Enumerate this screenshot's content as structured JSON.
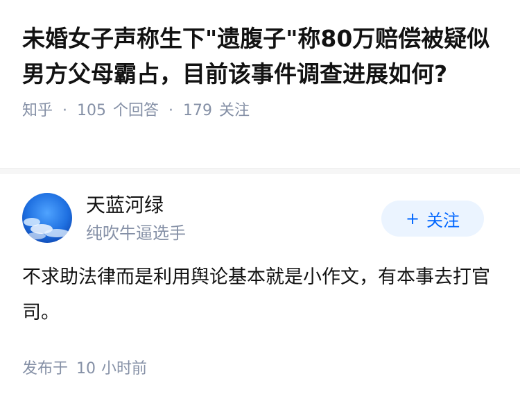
{
  "question": {
    "title": "未婚女子声称生下\"遗腹子\"称80万赔偿被疑似男方父母霸占，目前该事件调查进展如何?",
    "source": "知乎",
    "answer_count": "105",
    "answer_label": "个回答",
    "follower_count": "179",
    "follower_label": "关注"
  },
  "answer": {
    "author": {
      "name": "天蓝河绿",
      "headline": "纯吹牛逼选手",
      "avatar_icon": "sky-clouds-avatar"
    },
    "follow_button": {
      "icon": "plus-icon",
      "plus": "+",
      "label": "关注"
    },
    "content": "不求助法律而是利用舆论基本就是小作文，有本事去打官司。",
    "time_prefix": "发布于",
    "time_value": "10",
    "time_unit": "小时前"
  },
  "colors": {
    "meta_gray": "#8590a6",
    "accent_blue": "#0066ff",
    "follow_bg": "#ebf4ff"
  }
}
